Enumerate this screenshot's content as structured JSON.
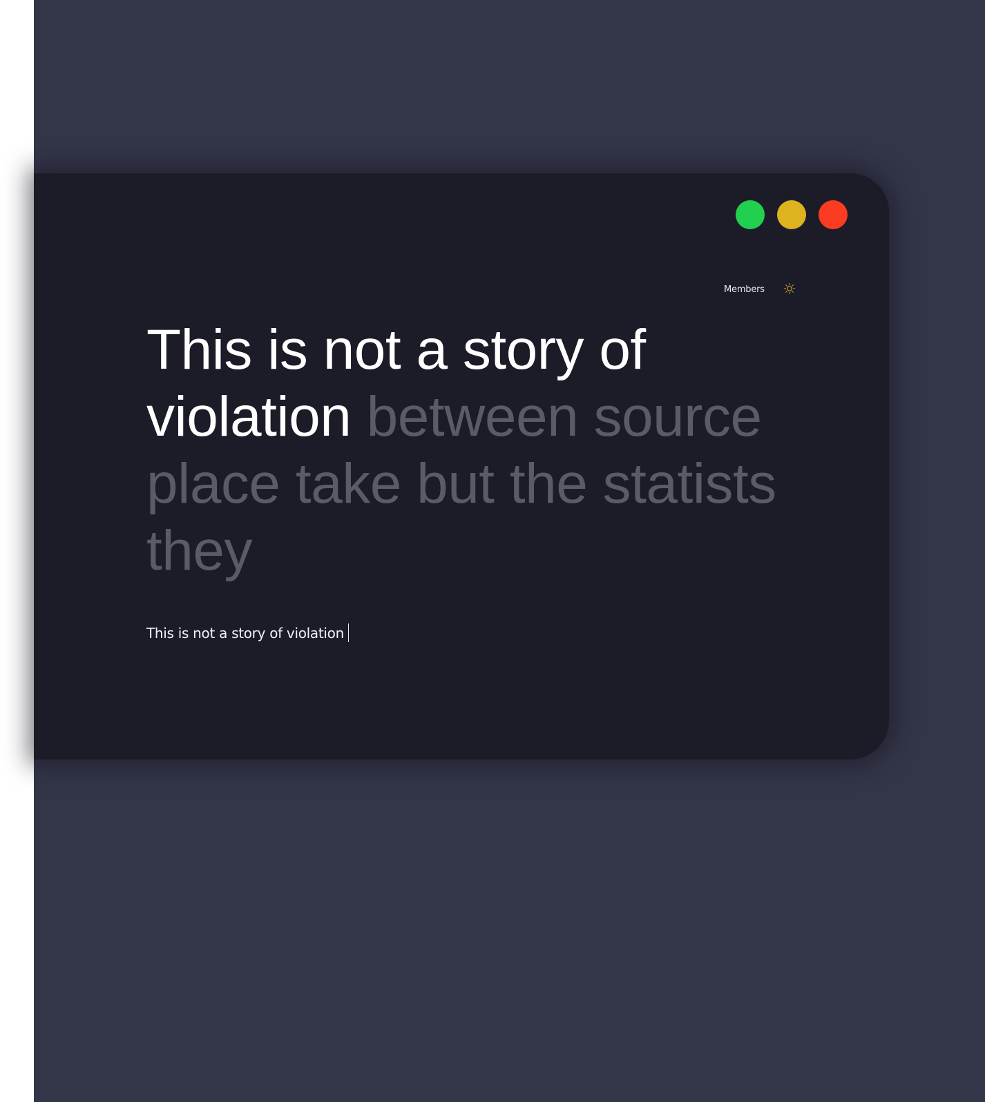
{
  "window_controls": {
    "green": "#22d04f",
    "yellow": "#ddb420",
    "red": "#fb3b22"
  },
  "nav": {
    "members_label": "Members",
    "theme_icon": "sun-icon",
    "theme_icon_color": "#e0b02a"
  },
  "prompt": {
    "typed": "This is not a story of violation",
    "remaining": "between source place take but the statists they"
  },
  "input": {
    "value": "This is not a story of violation"
  },
  "colors": {
    "background": "#333549",
    "window": "#1c1c28",
    "typed_text": "#ffffff",
    "remaining_text": "#5b5b66"
  }
}
